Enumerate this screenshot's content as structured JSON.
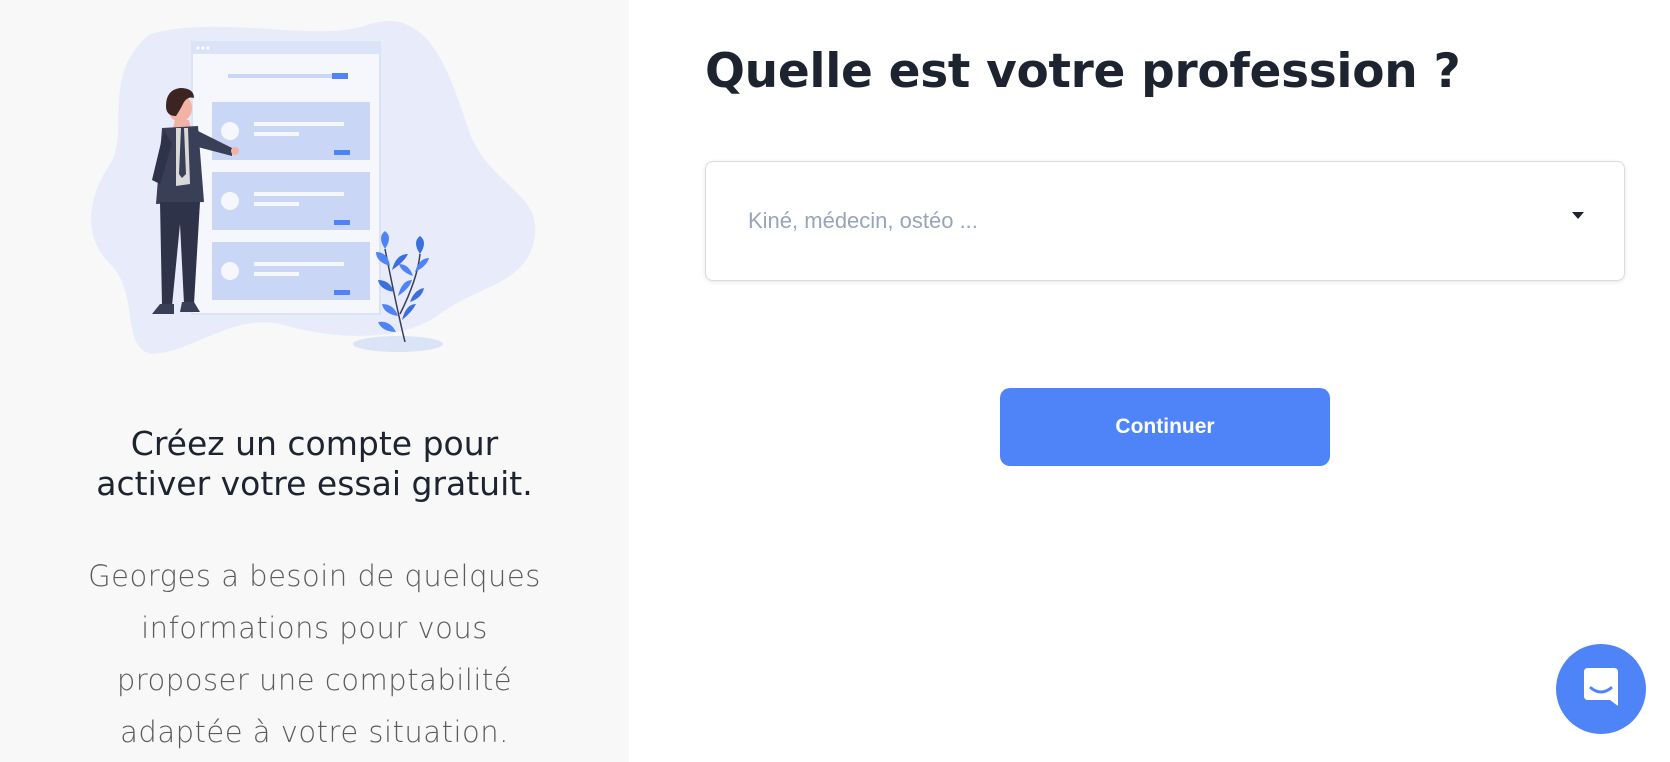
{
  "left_panel": {
    "heading_lines": [
      "Créez un compte pour",
      "activer votre essai gratuit."
    ],
    "description_lines": [
      "Georges a besoin de quelques",
      "informations pour vous",
      "proposer une comptabilité",
      "adaptée à votre situation."
    ],
    "illustration_icon": "person-presenting-list-illustration"
  },
  "form": {
    "title": "Quelle est votre profession ?",
    "profession_select": {
      "placeholder": "Kiné, médecin, ostéo ...",
      "value": "",
      "caret_icon": "caret-down-icon"
    },
    "continue_label": "Continuer"
  },
  "chat": {
    "icon": "chat-bubble-icon"
  },
  "colors": {
    "accent": "#4f84f9",
    "left_background": "#f8f8f8",
    "text_dark": "#1d2430",
    "placeholder": "#9aa4b8",
    "illustration_blob": "#e8ecfa",
    "illustration_card": "#c9d6f5"
  }
}
